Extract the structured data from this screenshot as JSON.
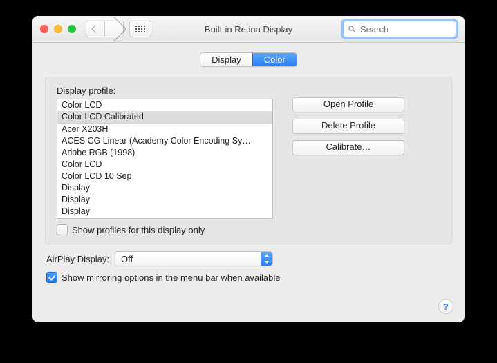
{
  "window": {
    "title": "Built-in Retina Display"
  },
  "search": {
    "placeholder": "Search"
  },
  "tabs": {
    "display": "Display",
    "color": "Color",
    "active": "color"
  },
  "panel": {
    "label": "Display profile:",
    "profiles": [
      "Color LCD",
      "Color LCD Calibrated",
      "Acer X203H",
      "ACES CG Linear (Academy Color Encoding Sy…",
      "Adobe RGB (1998)",
      "Color LCD",
      "Color LCD 10 Sep",
      "Display",
      "Display",
      "Display"
    ],
    "selected_index": 1,
    "divider_after_index": 1,
    "show_only_label": "Show profiles for this display only",
    "show_only_checked": false,
    "buttons": {
      "open": "Open Profile",
      "delete": "Delete Profile",
      "calibrate": "Calibrate…"
    }
  },
  "airplay": {
    "label": "AirPlay Display:",
    "value": "Off"
  },
  "mirror": {
    "label": "Show mirroring options in the menu bar when available",
    "checked": true
  },
  "help": {
    "glyph": "?"
  }
}
